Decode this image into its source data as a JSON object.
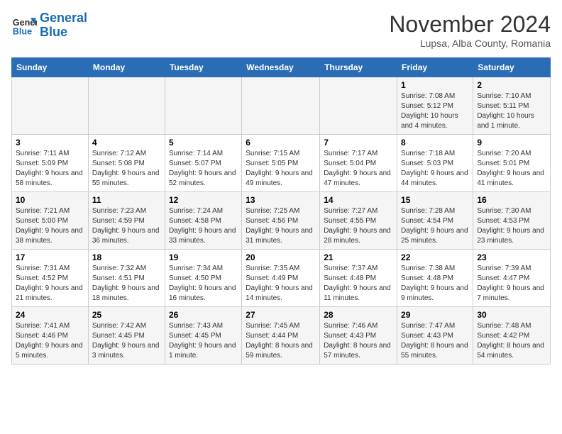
{
  "logo": {
    "line1": "General",
    "line2": "Blue"
  },
  "title": "November 2024",
  "location": "Lupsa, Alba County, Romania",
  "days_of_week": [
    "Sunday",
    "Monday",
    "Tuesday",
    "Wednesday",
    "Thursday",
    "Friday",
    "Saturday"
  ],
  "weeks": [
    [
      {
        "num": "",
        "info": ""
      },
      {
        "num": "",
        "info": ""
      },
      {
        "num": "",
        "info": ""
      },
      {
        "num": "",
        "info": ""
      },
      {
        "num": "",
        "info": ""
      },
      {
        "num": "1",
        "info": "Sunrise: 7:08 AM\nSunset: 5:12 PM\nDaylight: 10 hours and 4 minutes."
      },
      {
        "num": "2",
        "info": "Sunrise: 7:10 AM\nSunset: 5:11 PM\nDaylight: 10 hours and 1 minute."
      }
    ],
    [
      {
        "num": "3",
        "info": "Sunrise: 7:11 AM\nSunset: 5:09 PM\nDaylight: 9 hours and 58 minutes."
      },
      {
        "num": "4",
        "info": "Sunrise: 7:12 AM\nSunset: 5:08 PM\nDaylight: 9 hours and 55 minutes."
      },
      {
        "num": "5",
        "info": "Sunrise: 7:14 AM\nSunset: 5:07 PM\nDaylight: 9 hours and 52 minutes."
      },
      {
        "num": "6",
        "info": "Sunrise: 7:15 AM\nSunset: 5:05 PM\nDaylight: 9 hours and 49 minutes."
      },
      {
        "num": "7",
        "info": "Sunrise: 7:17 AM\nSunset: 5:04 PM\nDaylight: 9 hours and 47 minutes."
      },
      {
        "num": "8",
        "info": "Sunrise: 7:18 AM\nSunset: 5:03 PM\nDaylight: 9 hours and 44 minutes."
      },
      {
        "num": "9",
        "info": "Sunrise: 7:20 AM\nSunset: 5:01 PM\nDaylight: 9 hours and 41 minutes."
      }
    ],
    [
      {
        "num": "10",
        "info": "Sunrise: 7:21 AM\nSunset: 5:00 PM\nDaylight: 9 hours and 38 minutes."
      },
      {
        "num": "11",
        "info": "Sunrise: 7:23 AM\nSunset: 4:59 PM\nDaylight: 9 hours and 36 minutes."
      },
      {
        "num": "12",
        "info": "Sunrise: 7:24 AM\nSunset: 4:58 PM\nDaylight: 9 hours and 33 minutes."
      },
      {
        "num": "13",
        "info": "Sunrise: 7:25 AM\nSunset: 4:56 PM\nDaylight: 9 hours and 31 minutes."
      },
      {
        "num": "14",
        "info": "Sunrise: 7:27 AM\nSunset: 4:55 PM\nDaylight: 9 hours and 28 minutes."
      },
      {
        "num": "15",
        "info": "Sunrise: 7:28 AM\nSunset: 4:54 PM\nDaylight: 9 hours and 25 minutes."
      },
      {
        "num": "16",
        "info": "Sunrise: 7:30 AM\nSunset: 4:53 PM\nDaylight: 9 hours and 23 minutes."
      }
    ],
    [
      {
        "num": "17",
        "info": "Sunrise: 7:31 AM\nSunset: 4:52 PM\nDaylight: 9 hours and 21 minutes."
      },
      {
        "num": "18",
        "info": "Sunrise: 7:32 AM\nSunset: 4:51 PM\nDaylight: 9 hours and 18 minutes."
      },
      {
        "num": "19",
        "info": "Sunrise: 7:34 AM\nSunset: 4:50 PM\nDaylight: 9 hours and 16 minutes."
      },
      {
        "num": "20",
        "info": "Sunrise: 7:35 AM\nSunset: 4:49 PM\nDaylight: 9 hours and 14 minutes."
      },
      {
        "num": "21",
        "info": "Sunrise: 7:37 AM\nSunset: 4:48 PM\nDaylight: 9 hours and 11 minutes."
      },
      {
        "num": "22",
        "info": "Sunrise: 7:38 AM\nSunset: 4:48 PM\nDaylight: 9 hours and 9 minutes."
      },
      {
        "num": "23",
        "info": "Sunrise: 7:39 AM\nSunset: 4:47 PM\nDaylight: 9 hours and 7 minutes."
      }
    ],
    [
      {
        "num": "24",
        "info": "Sunrise: 7:41 AM\nSunset: 4:46 PM\nDaylight: 9 hours and 5 minutes."
      },
      {
        "num": "25",
        "info": "Sunrise: 7:42 AM\nSunset: 4:45 PM\nDaylight: 9 hours and 3 minutes."
      },
      {
        "num": "26",
        "info": "Sunrise: 7:43 AM\nSunset: 4:45 PM\nDaylight: 9 hours and 1 minute."
      },
      {
        "num": "27",
        "info": "Sunrise: 7:45 AM\nSunset: 4:44 PM\nDaylight: 8 hours and 59 minutes."
      },
      {
        "num": "28",
        "info": "Sunrise: 7:46 AM\nSunset: 4:43 PM\nDaylight: 8 hours and 57 minutes."
      },
      {
        "num": "29",
        "info": "Sunrise: 7:47 AM\nSunset: 4:43 PM\nDaylight: 8 hours and 55 minutes."
      },
      {
        "num": "30",
        "info": "Sunrise: 7:48 AM\nSunset: 4:42 PM\nDaylight: 8 hours and 54 minutes."
      }
    ]
  ]
}
